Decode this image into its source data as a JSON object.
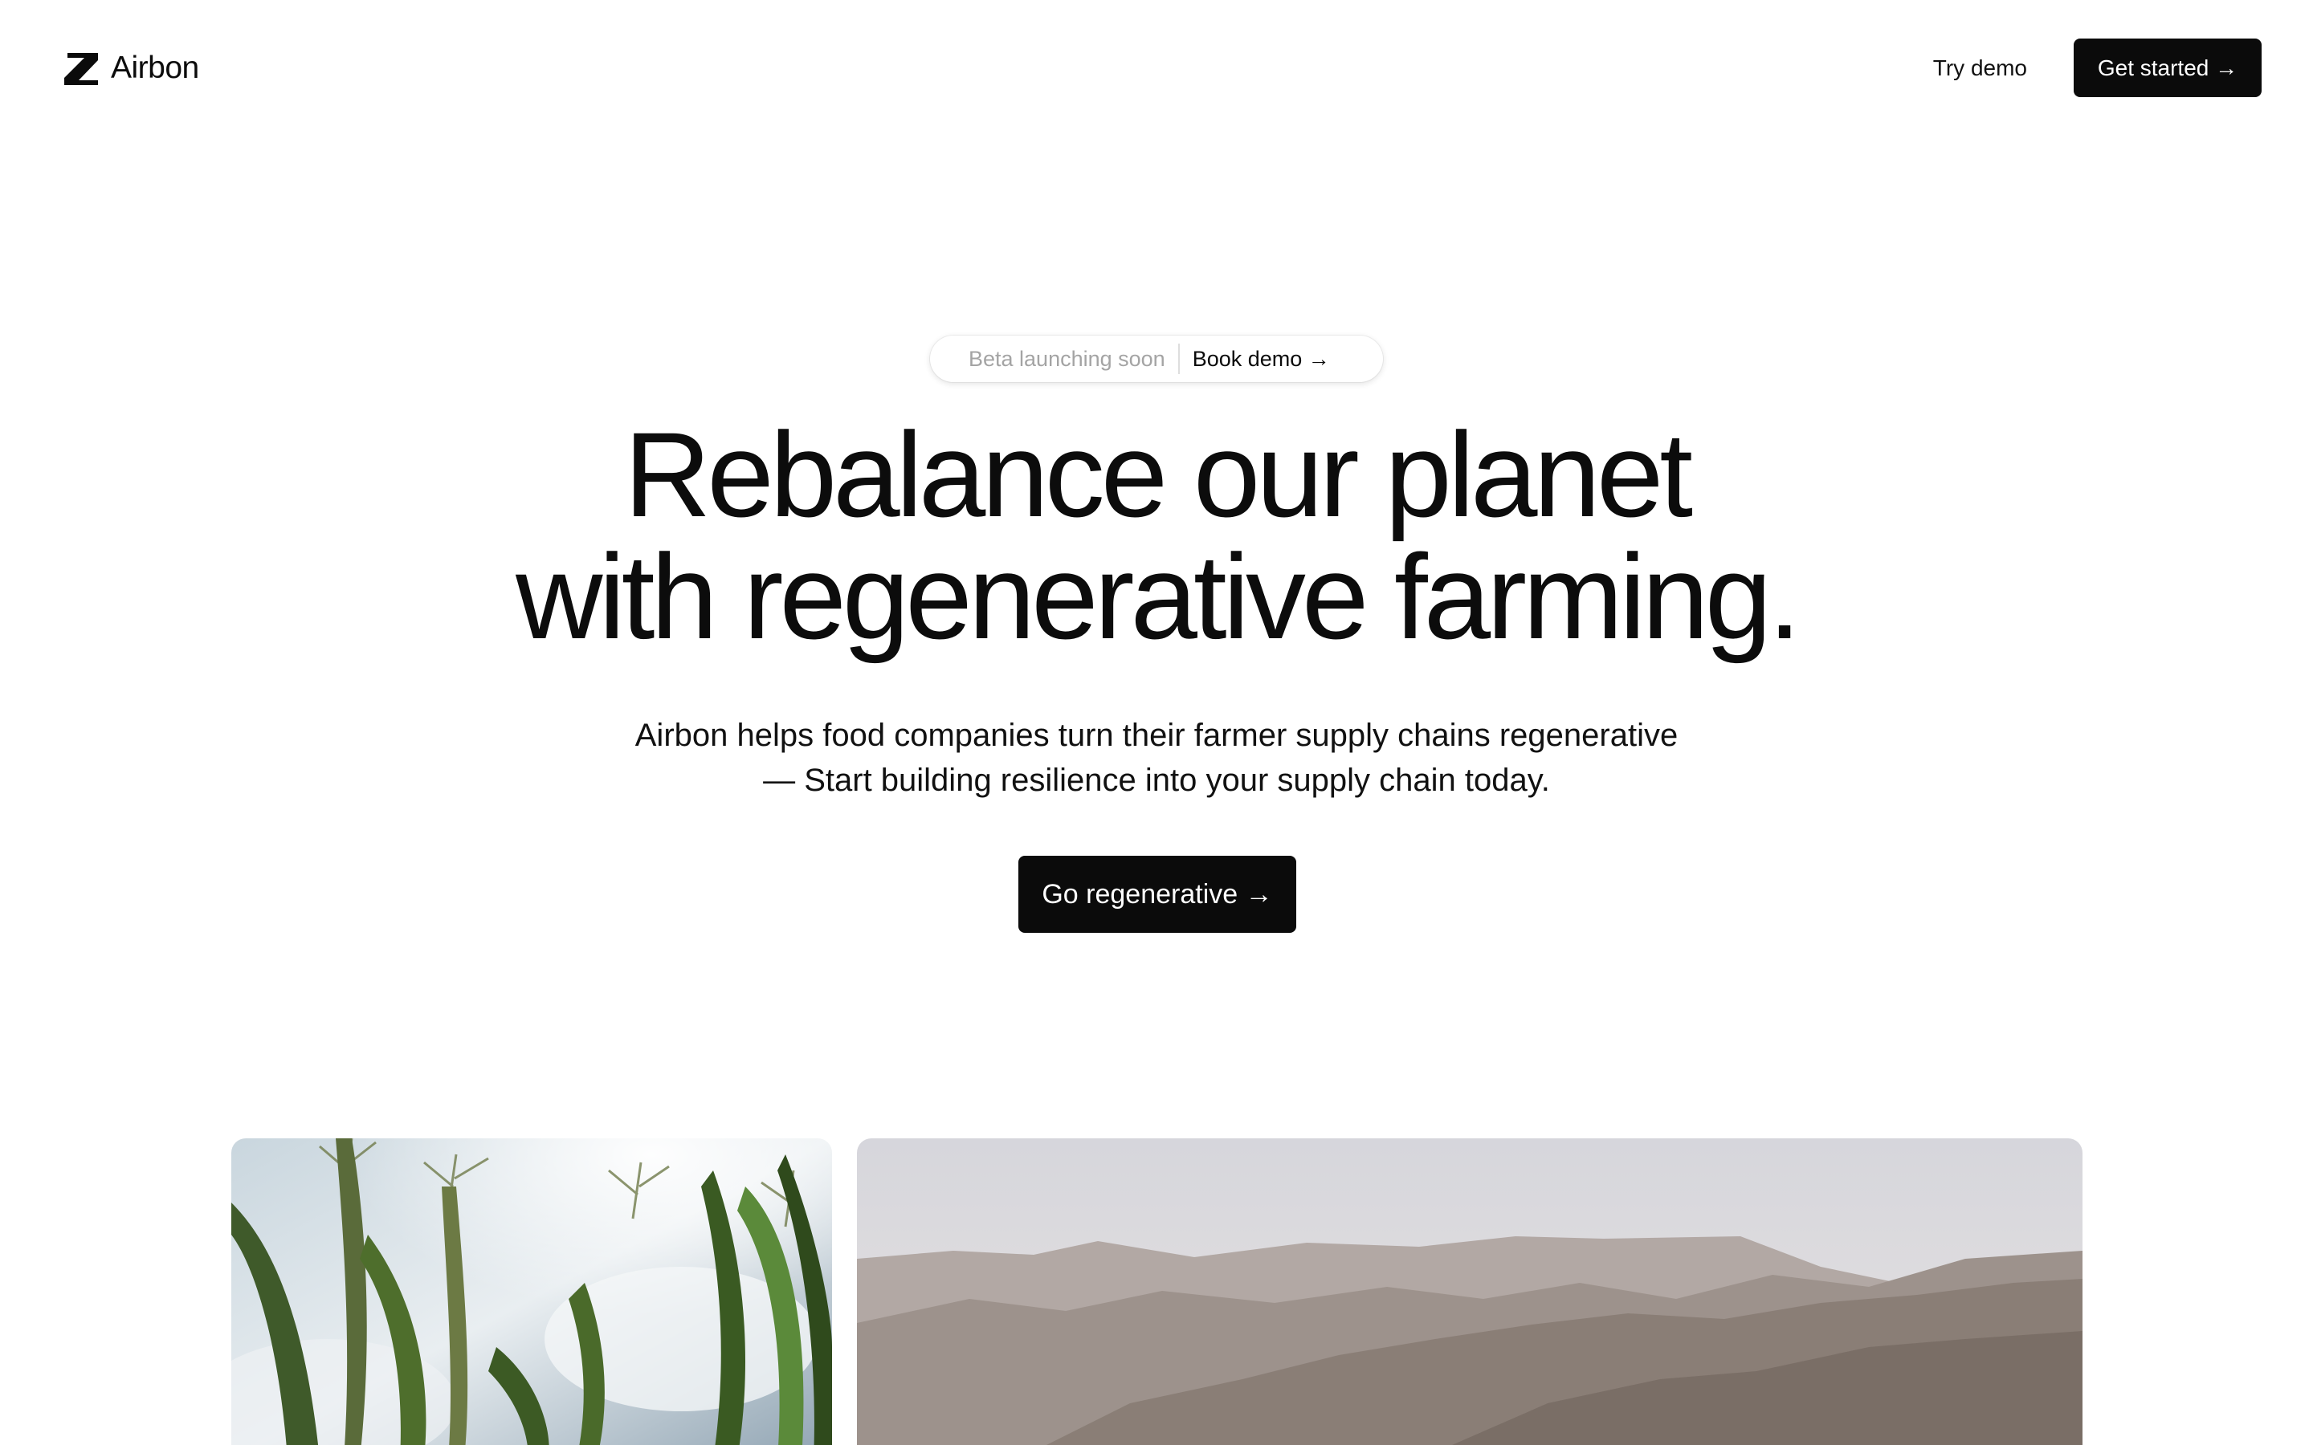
{
  "header": {
    "brand_name": "Airbon",
    "brand_icon": "airbon-logo",
    "nav": {
      "try_demo_label": "Try demo",
      "get_started_label": "Get started →"
    }
  },
  "hero": {
    "announcement": {
      "note": "Beta launching soon",
      "link_label": "Book demo →"
    },
    "headline_lines": [
      "Rebalance our planet",
      "with regenerative farming."
    ],
    "subtext_lines": [
      "Airbon helps food companies turn their farmer supply chains regenerative",
      "— Start building resilience into your supply chain today."
    ],
    "cta_label": "Go regenerative →"
  },
  "gallery": {
    "images": [
      {
        "subject": "corn-field-photo"
      },
      {
        "subject": "mountain-hills-photo"
      }
    ]
  },
  "colors": {
    "primary_button": "#0b0b0b",
    "button_text": "#ffffff",
    "muted_text": "#a4a4a4",
    "body_text": "#0c0c0c"
  }
}
